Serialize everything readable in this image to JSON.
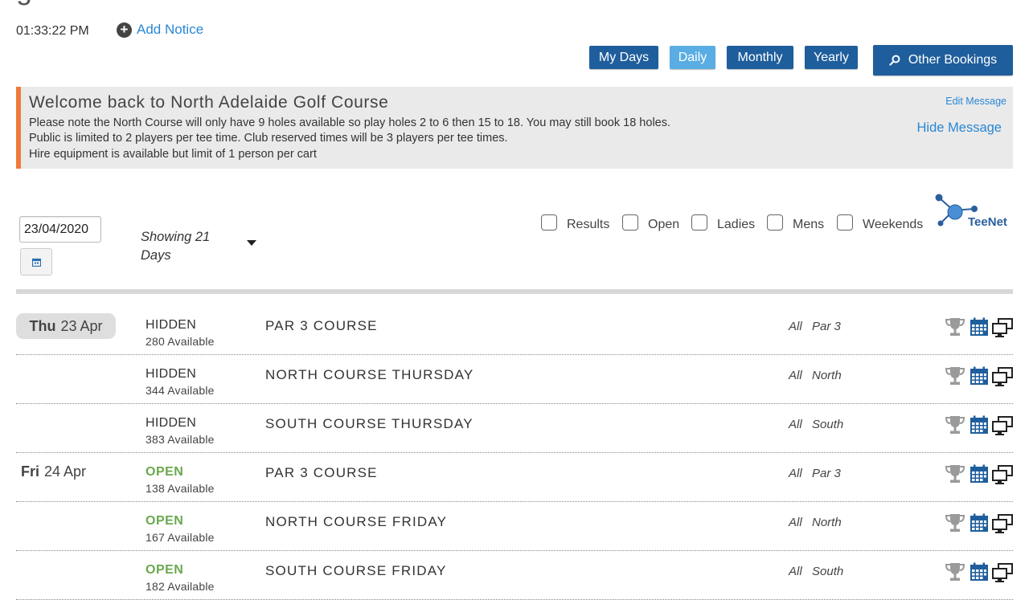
{
  "header": {
    "clock": "01:33:22 PM",
    "add_notice": "Add Notice",
    "views": [
      "My Days",
      "Daily",
      "Monthly",
      "Yearly"
    ],
    "active_view": "Daily",
    "other_bookings": "Other Bookings"
  },
  "notice": {
    "title": "Welcome back to North Adelaide Golf Course",
    "lines": [
      "Please note the North Course will only have 9 holes available so play holes 2 to 6 then 15 to 18. You may still book 18 holes.",
      "Public is limited to 2 players per tee time. Club reserved times will be 3 players per tee times.",
      "Hire equipment is available but limit of 1 person per cart"
    ],
    "edit": "Edit Message",
    "hide": "Hide Message",
    "accent_color": "#f07a3a"
  },
  "controls": {
    "date_value": "23/04/2020",
    "showing": "Showing 21 Days",
    "filters": [
      "Results",
      "Open",
      "Ladies",
      "Mens",
      "Weekends"
    ],
    "logo_text": "TeeNet"
  },
  "rows": [
    {
      "dow": "Thu",
      "date": "23 Apr",
      "status": "HIDDEN",
      "available": "280 Available",
      "course": "PAR 3 COURSE",
      "who": "All",
      "ctype": "Par 3"
    },
    {
      "dow": "",
      "date": "",
      "status": "HIDDEN",
      "available": "344 Available",
      "course": "NORTH COURSE THURSDAY",
      "who": "All",
      "ctype": "North"
    },
    {
      "dow": "",
      "date": "",
      "status": "HIDDEN",
      "available": "383 Available",
      "course": "SOUTH COURSE THURSDAY",
      "who": "All",
      "ctype": "South"
    },
    {
      "dow": "Fri",
      "date": "24 Apr",
      "status": "OPEN",
      "available": "138 Available",
      "course": "PAR 3 COURSE",
      "who": "All",
      "ctype": "Par 3"
    },
    {
      "dow": "",
      "date": "",
      "status": "OPEN",
      "available": "167 Available",
      "course": "NORTH COURSE FRIDAY",
      "who": "All",
      "ctype": "North"
    },
    {
      "dow": "",
      "date": "",
      "status": "OPEN",
      "available": "182 Available",
      "course": "SOUTH COURSE FRIDAY",
      "who": "All",
      "ctype": "South"
    }
  ],
  "colors": {
    "primary_button": "#1f5e9c",
    "active_button": "#5aade3",
    "link": "#2a87d4",
    "open_status": "#6aa84f"
  }
}
